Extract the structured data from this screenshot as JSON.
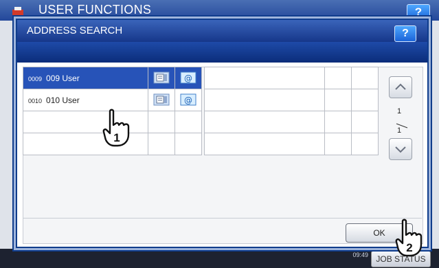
{
  "background": {
    "title": "USER FUNCTIONS",
    "help_label": "?",
    "clock": "09:49",
    "job_status_label": "JOB STATUS",
    "icon": "printer-icon"
  },
  "dialog": {
    "title": "ADDRESS SEARCH",
    "help_label": "?",
    "ok_label": "OK"
  },
  "results": [
    {
      "number": "0009",
      "name": "009 User",
      "selected": true,
      "icons": [
        "fax-icon",
        "email-icon"
      ]
    },
    {
      "number": "0010",
      "name": "010 User",
      "selected": false,
      "icons": [
        "fax-icon",
        "email-icon"
      ]
    },
    {
      "number": "",
      "name": "",
      "selected": false,
      "icons": []
    },
    {
      "number": "",
      "name": "",
      "selected": false,
      "icons": []
    }
  ],
  "pagination": {
    "current": "1",
    "total": "1"
  },
  "annotations": {
    "step1": "1",
    "step2": "2"
  },
  "colors": {
    "title_bar": "#23479a",
    "selected_row": "#2753b8",
    "dialog_border": "#0f3c8c"
  }
}
